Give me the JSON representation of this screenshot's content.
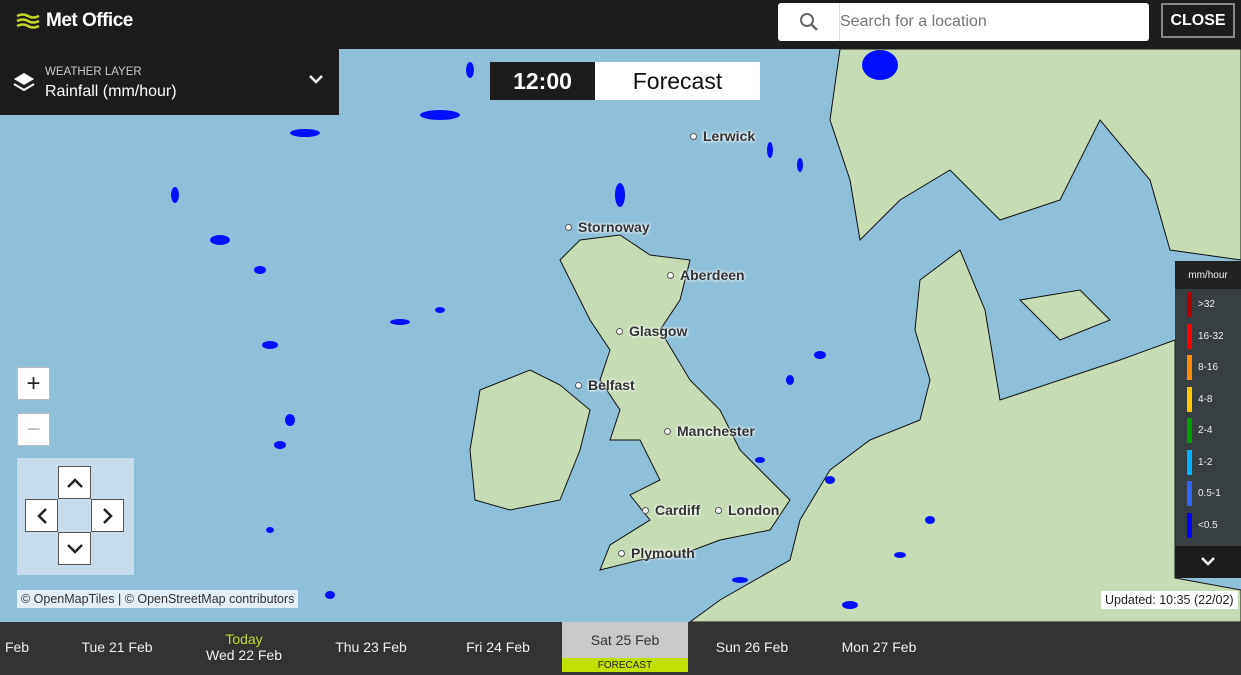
{
  "header": {
    "brand": "Met Office",
    "search_placeholder": "Search for a location",
    "close_label": "CLOSE"
  },
  "layer": {
    "label": "WEATHER LAYER",
    "value": "Rainfall (mm/hour)"
  },
  "time": {
    "clock": "12:00",
    "mode": "Forecast"
  },
  "cities": [
    {
      "name": "Lerwick"
    },
    {
      "name": "Stornoway"
    },
    {
      "name": "Aberdeen"
    },
    {
      "name": "Glasgow"
    },
    {
      "name": "Belfast"
    },
    {
      "name": "Manchester"
    },
    {
      "name": "Cardiff"
    },
    {
      "name": "London"
    },
    {
      "name": "Plymouth"
    }
  ],
  "controls": {
    "zoom_in": "+",
    "zoom_out": "−"
  },
  "attribution": "© OpenMapTiles | © OpenStreetMap contributors",
  "updated": "Updated: 10:35 (22/02)",
  "legend": {
    "title": "mm/hour",
    "items": [
      {
        "label": ">32",
        "color": "#b00000"
      },
      {
        "label": "16-32",
        "color": "#ff0000"
      },
      {
        "label": "8-16",
        "color": "#ff8c00"
      },
      {
        "label": "4-8",
        "color": "#ffc800"
      },
      {
        "label": "2-4",
        "color": "#00a000"
      },
      {
        "label": "1-2",
        "color": "#00b4ff"
      },
      {
        "label": "0.5-1",
        "color": "#3264ff"
      },
      {
        "label": "<0.5",
        "color": "#0000ff"
      }
    ]
  },
  "timeline": {
    "days": [
      {
        "label": "Feb"
      },
      {
        "label": "Tue 21 Feb"
      },
      {
        "today": "Today",
        "label": "Wed 22 Feb"
      },
      {
        "label": "Thu 23 Feb"
      },
      {
        "label": "Fri 24 Feb"
      },
      {
        "label": "Sat 25 Feb"
      },
      {
        "label": "Sun 26 Feb"
      },
      {
        "label": "Mon 27 Feb"
      }
    ],
    "selected_tag": "FORECAST"
  },
  "colors": {
    "accent": "#c5d82b",
    "sea": "#8fc0d9",
    "land": "#c5dcb5",
    "rain": "#0000ff"
  }
}
